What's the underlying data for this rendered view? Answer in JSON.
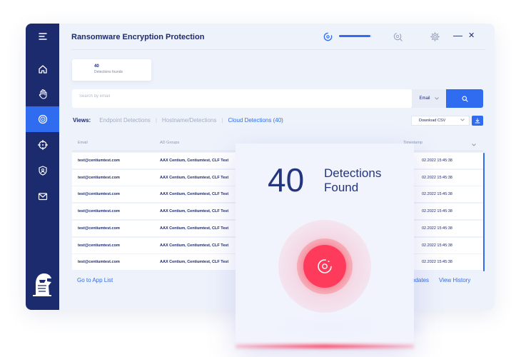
{
  "app": {
    "title": "Ransomware Encryption Protection"
  },
  "titlebar": {
    "progress_fraction": 0.95,
    "minimize": "—",
    "close": "✕"
  },
  "sidebar": {
    "items": [
      {
        "icon": "home-icon"
      },
      {
        "icon": "hand-stop-icon"
      },
      {
        "icon": "target-face-icon",
        "active": true
      },
      {
        "icon": "crosshair-icon"
      },
      {
        "icon": "shield-user-icon"
      },
      {
        "icon": "mail-icon"
      }
    ]
  },
  "summary_card": {
    "count": "40",
    "label": "Detections founds"
  },
  "search": {
    "placeholder": "Search by email",
    "filter_value": "Email"
  },
  "views": {
    "label": "Views:",
    "tabs": [
      {
        "label": "Endpoint Detections",
        "active": false
      },
      {
        "label": "Hostname/Detections",
        "active": false
      },
      {
        "label": "Cloud Detections (40)",
        "active": true
      }
    ]
  },
  "download": {
    "label": "Download CSV"
  },
  "table": {
    "headers": {
      "email": "Email",
      "ad_groups": "AD Groups",
      "timestamp": "Timestamp"
    },
    "rows": [
      {
        "email": "test@centiumtest.com",
        "ad_groups": "AAX Centium, Centiumtest, CLF Test",
        "timestamp": "02.2022 15:45:38"
      },
      {
        "email": "test@centiumtest.com",
        "ad_groups": "AAX Centium, Centiumtest, CLF Test",
        "timestamp": "02.2022 15:45:38"
      },
      {
        "email": "test@centiumtest.com",
        "ad_groups": "AAX Centium, Centiumtest, CLF Test",
        "timestamp": "02.2022 15:45:38"
      },
      {
        "email": "test@centiumtest.com",
        "ad_groups": "AAX Centium, Centiumtest, CLF Test",
        "timestamp": "02.2022 15:45:38"
      },
      {
        "email": "test@centiumtest.com",
        "ad_groups": "AAX Centium, Centiumtest, CLF Test",
        "timestamp": "02.2022 15:45:38"
      },
      {
        "email": "test@centiumtest.com",
        "ad_groups": "AAX Centium, Centiumtest, CLF Test",
        "timestamp": "02.2022 15:45:38"
      },
      {
        "email": "test@centiumtest.com",
        "ad_groups": "AAX Centium, Centiumtest, CLF Test",
        "timestamp": "02.2022 15:45:38"
      }
    ]
  },
  "footer": {
    "go_to_app_list": "Go to App List",
    "updates": "pdates",
    "view_history": "View History"
  },
  "overlay": {
    "count": "40",
    "label": "Detections Found"
  },
  "colors": {
    "accent": "#2f6cf0",
    "navy": "#1c2a6e",
    "alert": "#ff3b5c"
  }
}
